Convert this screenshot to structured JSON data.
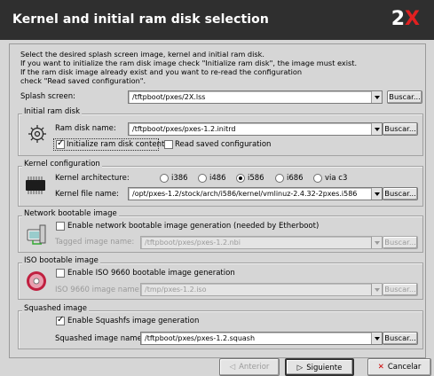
{
  "window": {
    "title": "Kernel and initial ram disk selection",
    "logo_text": "2",
    "logo_accent": "X"
  },
  "intro_lines": [
    "Select the desired splash screen image, kernel and initial ram disk.",
    "If you want to initialize the ram disk image check \"Initialize ram disk\", the image must exist.",
    "If the ram disk image already exist and you want to re-read the configuration",
    "check \"Read saved configuration\"."
  ],
  "splash": {
    "label": "Splash screen:",
    "value": "/tftpboot/pxes/2X.lss",
    "browse": "Buscar..."
  },
  "initrd": {
    "group_title": "Initial ram disk",
    "label": "Ram disk name:",
    "value": "/tftpboot/pxes/pxes-1.2.initrd",
    "browse": "Buscar...",
    "init_label": "Initialize ram disk contents",
    "init_checked": true,
    "read_label": "Read saved configuration",
    "read_checked": false
  },
  "kernel": {
    "group_title": "Kernel configuration",
    "arch_label": "Kernel architecture:",
    "arch_options": [
      "i386",
      "i486",
      "i586",
      "i686",
      "via c3"
    ],
    "arch_selected": "i586",
    "file_label": "Kernel file name:",
    "file_value": "/opt/pxes-1.2/stock/arch/i586/kernel/vmlinuz-2.4.32-2pxes.i586",
    "browse": "Buscar..."
  },
  "network": {
    "group_title": "Network bootable image",
    "enable_label": "Enable network bootable image generation (needed by Etherboot)",
    "enable_checked": false,
    "image_label": "Tagged image name:",
    "image_value": "/tftpboot/pxes/pxes-1.2.nbi",
    "browse": "Buscar..."
  },
  "iso": {
    "group_title": "ISO bootable image",
    "enable_label": "Enable ISO 9660 bootable image generation",
    "enable_checked": false,
    "image_label": "ISO 9660 image name:",
    "image_value": "/tmp/pxes-1.2.iso",
    "browse": "Buscar..."
  },
  "squashed": {
    "group_title": "Squashed image",
    "enable_label": "Enable Squashfs image generation",
    "enable_checked": true,
    "image_label": "Squashed image name:",
    "image_value": "/tftpboot/pxes/pxes-1.2.squash",
    "browse": "Buscar..."
  },
  "footer": {
    "back": "Anterior",
    "next": "Siguiente",
    "cancel": "Cancelar"
  }
}
